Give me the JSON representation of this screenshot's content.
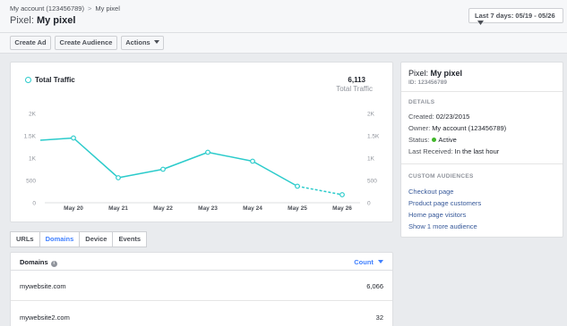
{
  "breadcrumb": {
    "account": "My account (123456789)",
    "sep": ">",
    "current": "My pixel"
  },
  "header": {
    "prefix": "Pixel:",
    "name": "My pixel",
    "date_range": "Last 7 days: 05/19 - 05/26"
  },
  "toolbar": {
    "create_ad": "Create Ad",
    "create_audience": "Create Audience",
    "actions": "Actions"
  },
  "chart_data": {
    "type": "line",
    "series": [
      {
        "name": "Total Traffic",
        "color": "#2bcbcb",
        "x": [
          "May 20",
          "May 21",
          "May 22",
          "May 23",
          "May 24",
          "May 25",
          "May 26"
        ],
        "values": [
          1450,
          560,
          750,
          1130,
          930,
          370,
          180
        ]
      }
    ],
    "prefix_value": 1400,
    "dashed_from": "May 25",
    "total_value": "6,113",
    "total_label": "Total Traffic",
    "yticks": [
      "0",
      "500",
      "1K",
      "1.5K",
      "2K"
    ],
    "ylim": [
      0,
      2000
    ],
    "grid": false
  },
  "info": {
    "title_prefix": "Pixel:",
    "title_name": "My pixel",
    "id": "ID: 123456789",
    "details_header": "DETAILS",
    "created_label": "Created:",
    "created_value": "02/23/2015",
    "owner_label": "Owner:",
    "owner_value": "My account (123456789)",
    "status_label": "Status:",
    "status_value": "Active",
    "received_label": "Last Received:",
    "received_value": "In the last hour",
    "audiences_header": "CUSTOM AUDIENCES",
    "audiences": [
      "Checkout page",
      "Product page customers",
      "Home page visitors",
      "Show 1 more audience"
    ]
  },
  "tabs": [
    "URLs",
    "Domains",
    "Device",
    "Events"
  ],
  "table": {
    "col_domains": "Domains",
    "col_count": "Count",
    "rows": [
      {
        "domain": "mywebsite.com",
        "count": "6,066"
      },
      {
        "domain": "mywebsite2.com",
        "count": "32"
      }
    ]
  }
}
